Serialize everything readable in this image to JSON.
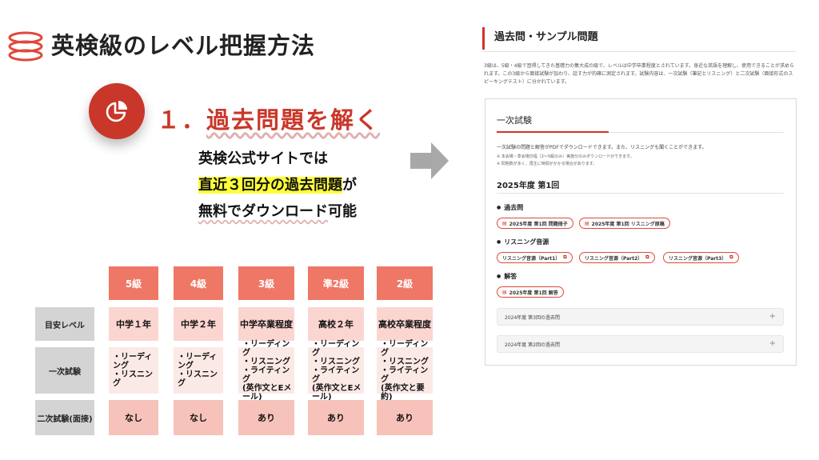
{
  "left": {
    "page_title": "英検級のレベル把握方法",
    "step_title_prefix": "１．",
    "step_title": "過去問題を解く",
    "desc_line1": "英検公式サイトでは",
    "desc_line2_mark": "直近３回分の過去問題",
    "desc_line2_tail": "が",
    "desc_line3_a": "無料でダウンロード",
    "desc_line3_b": "可能"
  },
  "table": {
    "headers": [
      "5級",
      "4級",
      "3級",
      "準2級",
      "2級"
    ],
    "row_labels": [
      "目安レベル",
      "一次試験",
      "二次試験(面接)"
    ],
    "level": [
      "中学１年",
      "中学２年",
      "中学卒業程度",
      "高校２年",
      "高校卒業程度"
    ],
    "first_exam": [
      [
        "・リーディング",
        "・リスニング"
      ],
      [
        "・リーディング",
        "・リスニング"
      ],
      [
        "・リーディング",
        "・リスニング",
        "・ライティング",
        "(英作文とEメール)"
      ],
      [
        "・リーディング",
        "・リスニング",
        "・ライティング",
        "(英作文とEメール)"
      ],
      [
        "・リーディング",
        "・リスニング",
        "・ライティング",
        "(英作文と要約)"
      ]
    ],
    "second_exam": [
      "なし",
      "なし",
      "あり",
      "あり",
      "あり"
    ]
  },
  "right": {
    "title": "過去問・サンプル問題",
    "intro": "3級は、5級・4級で習得してきた基礎力の集大成の級で、レベルは中学卒業程度とされています。身近な英語を理解し、使用できることが求められます。この3級から面接試験が加わり、話す力が的確に測定されます。試験内容は、一次試験（筆記とリスニング）と二次試験（面接形式のスピーキングテスト）に分かれています。",
    "box_title": "一次試験",
    "box_text": "一次試験の問題と解答がPDFでダウンロードできます。また、リスニングも聞くことができます。",
    "box_note1": "※ 本会場・準会場日程（2〜5級のみ）実施分のみダウンロードができます。",
    "box_note2": "※ 問題数が多く、再生に時間がかかる場合があります。",
    "year": "2025年度 第1回",
    "sub_past": "過去問",
    "pill_past1": "2025年度 第1回 問題冊子",
    "pill_past2": "2025年度 第1回 リスニング原稿",
    "sub_listen": "リスニング音源",
    "pill_l1": "リスニング音源（Part1）",
    "pill_l2": "リスニング音源（Part2）",
    "pill_l3": "リスニング音源（Part3）",
    "sub_answer": "解答",
    "pill_answer": "2025年度 第1回 解答",
    "acc1": "2024年度 第3回の過去問",
    "acc2": "2024年度 第2回の過去問"
  },
  "colors": {
    "accent": "#c9372a",
    "header": "#ef7766",
    "highlight": "#ffff3a"
  }
}
